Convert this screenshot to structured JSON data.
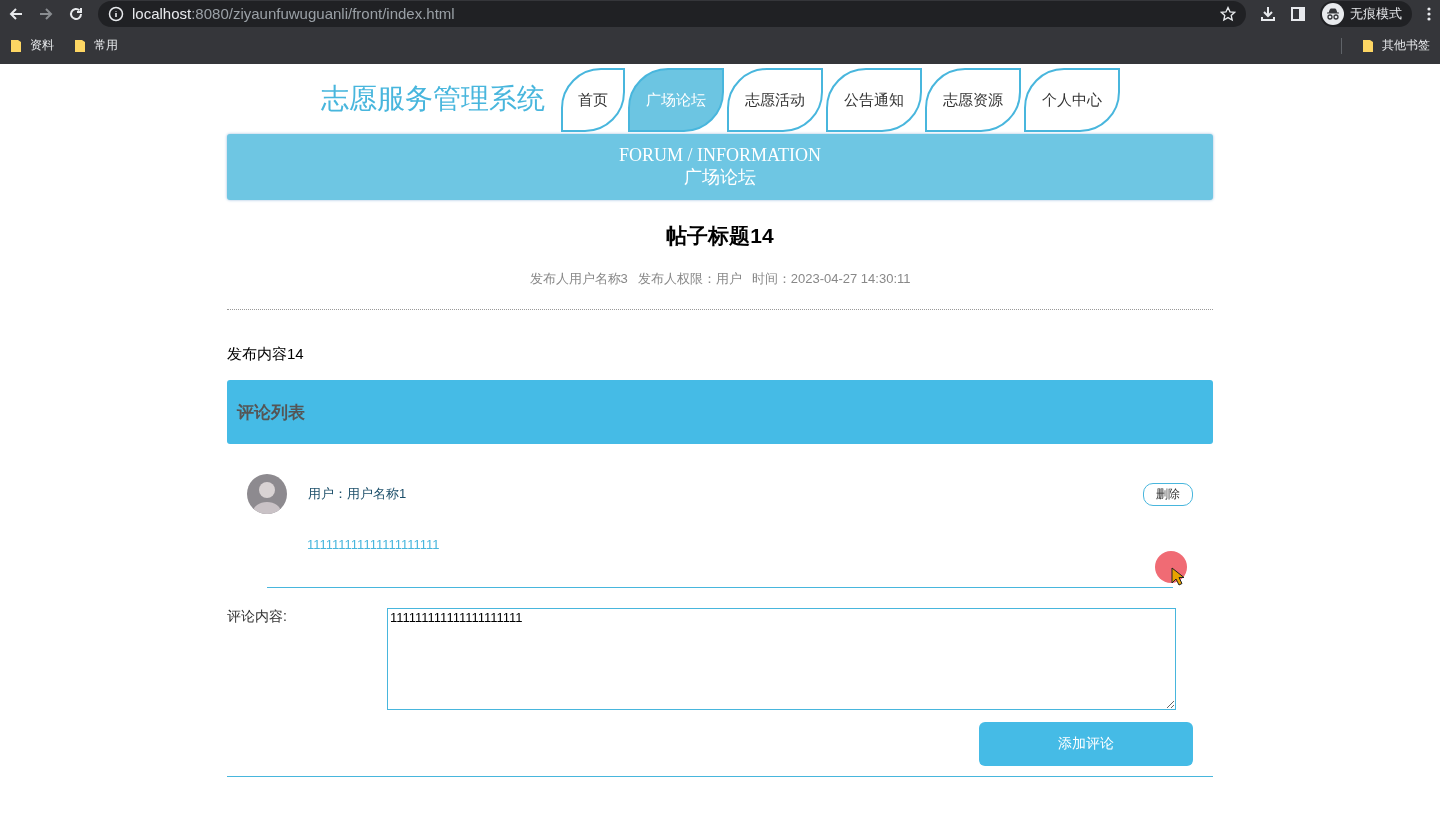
{
  "browser": {
    "url_host": "localhost",
    "url_path": ":8080/ziyaunfuwuguanli/front/index.html",
    "profile": "无痕模式",
    "bookmarks": [
      "资料",
      "常用"
    ],
    "other_bookmarks": "其他书签"
  },
  "site": {
    "logo": "志愿服务管理系统",
    "nav": [
      {
        "label": "首页",
        "selected": false
      },
      {
        "label": "广场论坛",
        "selected": true
      },
      {
        "label": "志愿活动",
        "selected": false
      },
      {
        "label": "公告通知",
        "selected": false
      },
      {
        "label": "志愿资源",
        "selected": false
      },
      {
        "label": "个人中心",
        "selected": false
      }
    ]
  },
  "banner": {
    "title_en": "FORUM / INFORMATION",
    "title": "广场论坛"
  },
  "post": {
    "title": "帖子标题14",
    "author": "发布人用户名称3",
    "role": "发布人权限：用户",
    "time": "时间：2023-04-27 14:30:11",
    "content": "发布内容14"
  },
  "comments": {
    "heading": "评论列表",
    "items": [
      {
        "user": "用户：用户名称1",
        "action": "删除",
        "text": "111111111111111111111"
      }
    ]
  },
  "form": {
    "label": "评论内容:",
    "value": "111111111111111111111",
    "submit": "添加评论"
  }
}
